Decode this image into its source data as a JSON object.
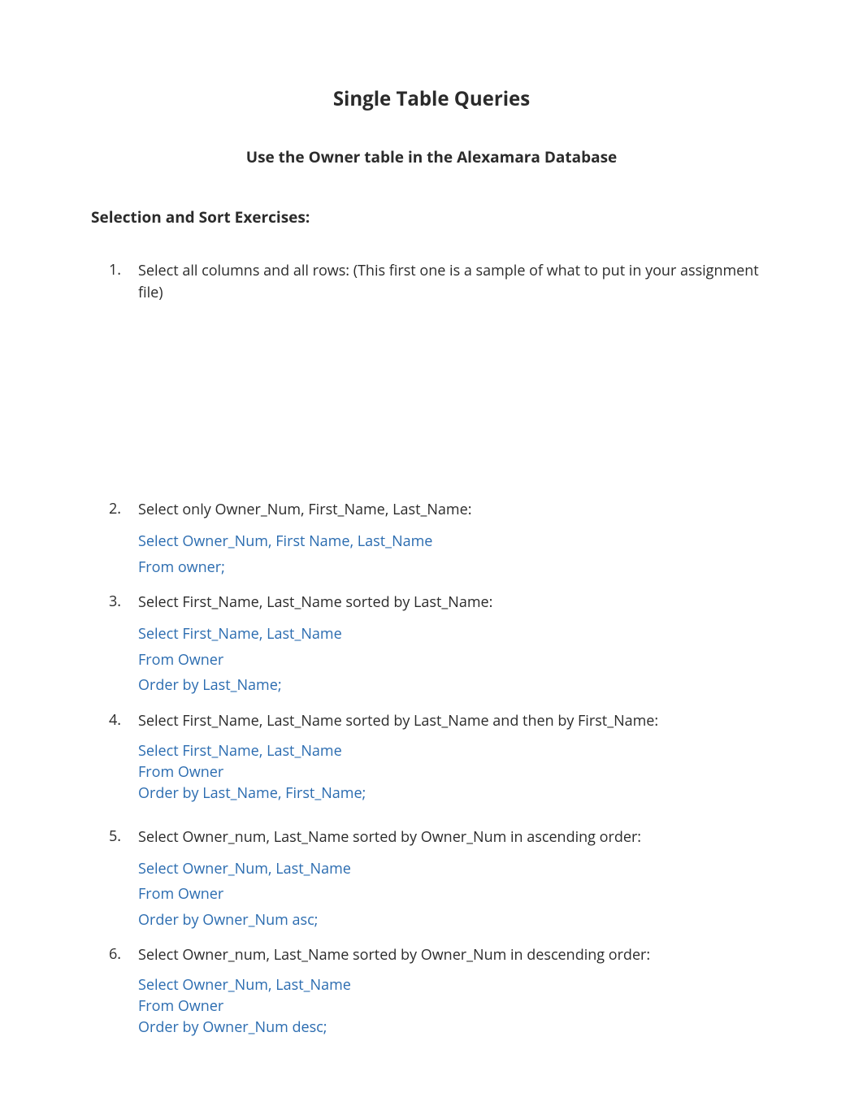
{
  "title": "Single Table Queries",
  "subtitle": "Use the Owner table in the Alexamara Database",
  "section_heading": "Selection and Sort Exercises:",
  "items": [
    {
      "question": "Select all columns and all rows: (This first one is a sample of what to put in your assignment file)",
      "answer_lines": []
    },
    {
      "question": "Select only Owner_Num, First_Name, Last_Name:",
      "answer_lines": [
        "Select Owner_Num, First Name, Last_Name",
        "From owner;"
      ]
    },
    {
      "question": "Select First_Name, Last_Name sorted by Last_Name:",
      "answer_lines": [
        "Select First_Name, Last_Name",
        "From Owner",
        "Order by Last_Name;"
      ]
    },
    {
      "question": "Select First_Name, Last_Name sorted by Last_Name and then by First_Name:",
      "answer_lines": [
        "Select First_Name, Last_Name",
        "From Owner",
        "Order by Last_Name, First_Name;"
      ]
    },
    {
      "question": "Select Owner_num, Last_Name sorted by Owner_Num in ascending order:",
      "answer_lines": [
        "Select Owner_Num, Last_Name",
        "From Owner",
        "Order by Owner_Num asc;"
      ]
    },
    {
      "question": "Select Owner_num, Last_Name sorted by Owner_Num in descending order:",
      "answer_lines": [
        "Select Owner_Num, Last_Name",
        "From Owner",
        "Order by Owner_Num desc;"
      ]
    }
  ]
}
